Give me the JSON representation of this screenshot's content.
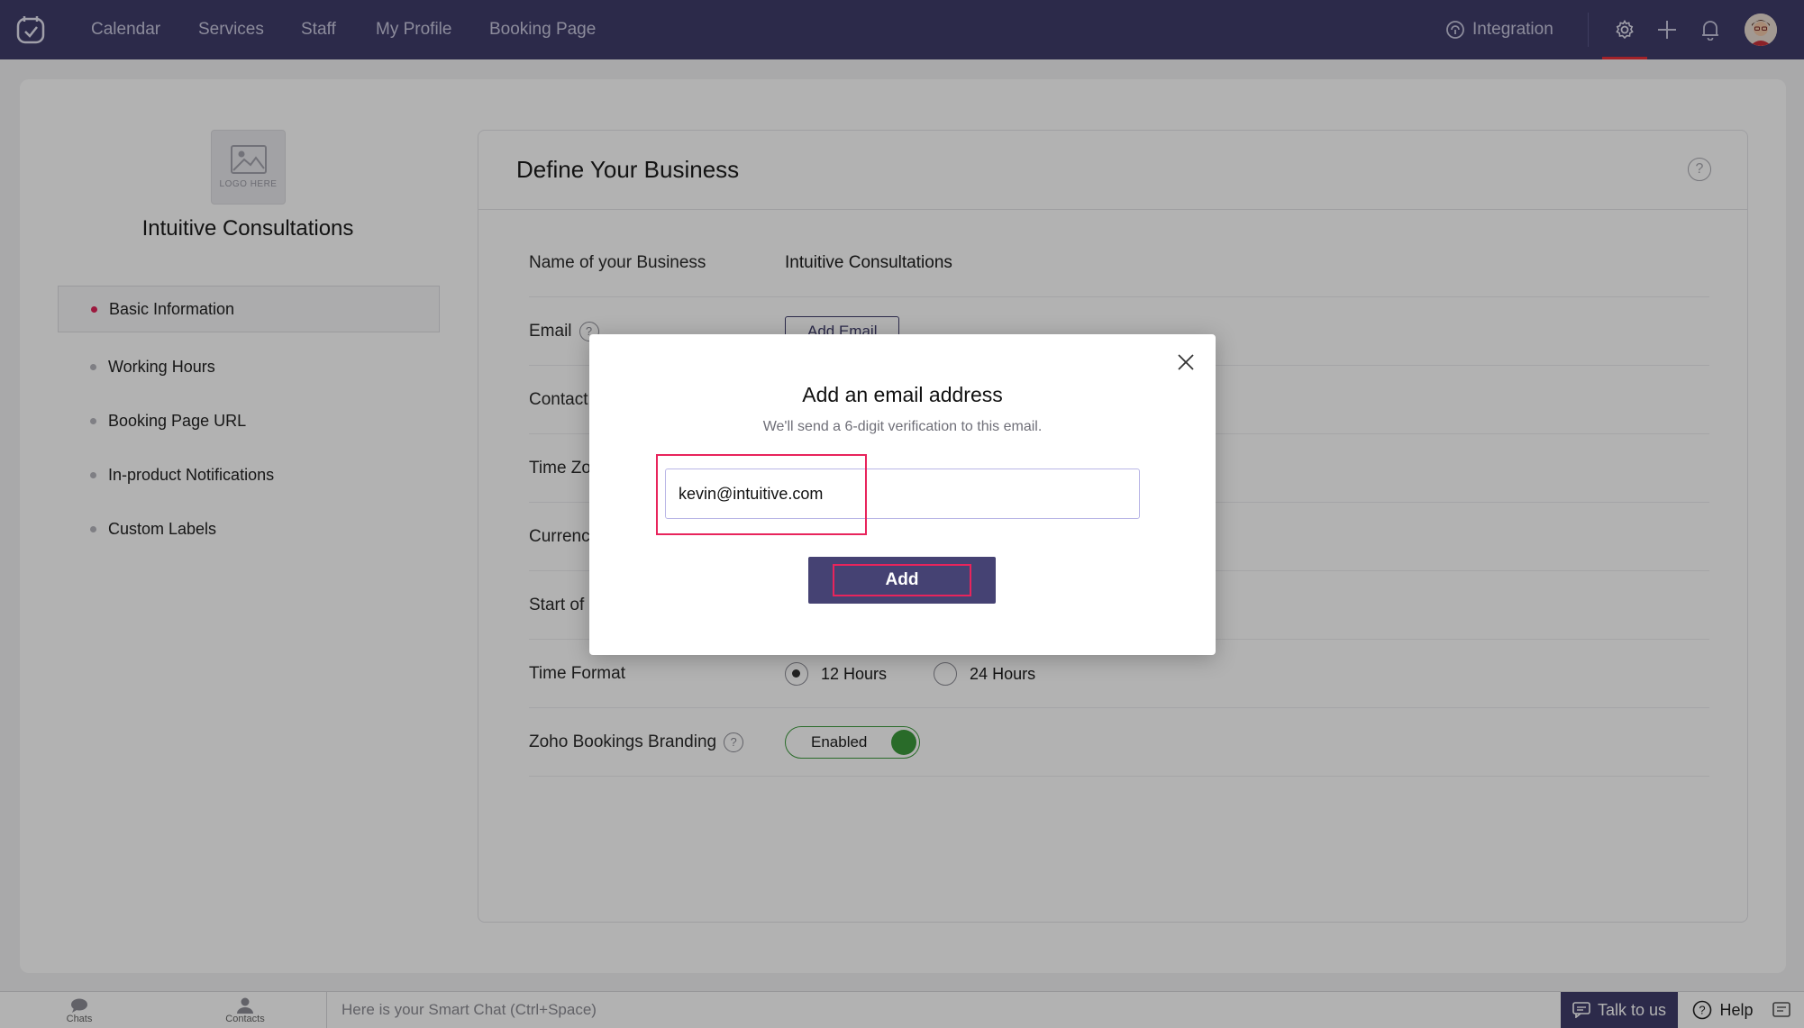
{
  "topnav": {
    "items": [
      "Calendar",
      "Services",
      "Staff",
      "My Profile",
      "Booking Page"
    ],
    "integration_label": "Integration"
  },
  "sidebar": {
    "business_name": "Intuitive Consultations",
    "logo_placeholder": "LOGO HERE",
    "items": [
      {
        "label": "Basic Information",
        "active": true
      },
      {
        "label": "Working Hours",
        "active": false
      },
      {
        "label": "Booking Page URL",
        "active": false
      },
      {
        "label": "In-product Notifications",
        "active": false
      },
      {
        "label": "Custom Labels",
        "active": false
      }
    ]
  },
  "panel": {
    "title": "Define Your Business",
    "rows": {
      "name_label": "Name of your Business",
      "name_value": "Intuitive Consultations",
      "email_label": "Email",
      "add_email_label": "Add Email",
      "contact_label": "Contact",
      "timezone_label": "Time Zone",
      "currency_label": "Currency",
      "start_label": "Start of",
      "time_format_label": "Time Format",
      "time_format_options": [
        "12 Hours",
        "24 Hours"
      ],
      "time_format_selected": "12 Hours",
      "branding_label": "Zoho Bookings Branding",
      "branding_value": "Enabled"
    }
  },
  "modal": {
    "title": "Add an email address",
    "subtitle": "We'll send a 6-digit verification to this email.",
    "email_value": "kevin@intuitive.com",
    "add_label": "Add"
  },
  "bottombar": {
    "chats_label": "Chats",
    "contacts_label": "Contacts",
    "smart_chat_placeholder": "Here is your Smart Chat (Ctrl+Space)",
    "talk_label": "Talk to us",
    "help_label": "Help"
  },
  "colors": {
    "nav_bg": "#3f3d6b",
    "accent_red": "#e8245c",
    "toggle_green": "#3c9a3c"
  }
}
